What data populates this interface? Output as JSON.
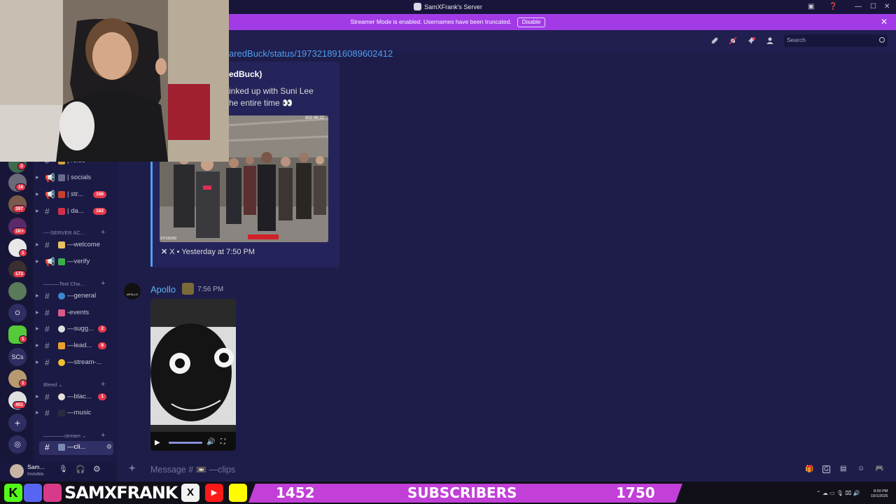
{
  "window": {
    "title": "SamXFrank's Server"
  },
  "banner": {
    "message": "Streamer Mode is enabled. Usernames have been truncated.",
    "disable_label": "Disable"
  },
  "header": {
    "search_placeholder": "Search"
  },
  "guilds": {
    "badges": [
      "3",
      "16",
      "397",
      "1K+",
      "1",
      "173",
      "1",
      "1",
      "401"
    ],
    "text_icons": [
      "O",
      "SCs"
    ]
  },
  "channels": {
    "items": [
      {
        "name": "| roles",
        "badge": ""
      },
      {
        "name": "| socials",
        "badge": ""
      },
      {
        "name": "| str...",
        "badge": "156"
      },
      {
        "name": "| da...",
        "badge": "162"
      },
      {
        "name": "—welcome",
        "badge": ""
      },
      {
        "name": "—verify",
        "badge": ""
      },
      {
        "name": "—general",
        "badge": ""
      },
      {
        "name": "-events",
        "badge": ""
      },
      {
        "name": "—sugg...",
        "badge": "2"
      },
      {
        "name": "—lead...",
        "badge": "8"
      },
      {
        "name": "—stream-...",
        "badge": ""
      },
      {
        "name": "—blac...",
        "badge": "1"
      },
      {
        "name": "—music",
        "badge": ""
      },
      {
        "name": "—cli...",
        "badge": ""
      }
    ],
    "categories": [
      "----SERVER AC...",
      "———Text Cha...",
      "Bleed",
      "————stream"
    ]
  },
  "user": {
    "name": "Sam...",
    "status": "Invisible"
  },
  "chat": {
    "embed_link": "aredBuck/status/1973218916089602412",
    "embed_author": "edBuck)",
    "embed_text_1": "inked up with Suni Lee",
    "embed_text_2": "he entire time 👀",
    "embed_footer": "X • Yesterday at 7:50 PM",
    "video_timer": "802:46:22",
    "video_counter": "37/16200",
    "message_author": "Apollo",
    "message_time": "7:56 PM",
    "avatar_text": "APOLLO"
  },
  "composer": {
    "placeholder": "Message # 📼 —clips"
  },
  "overlay": {
    "brand": "SAMXFRANK",
    "count_current": "1452",
    "label": "SUBSCRIBERS",
    "count_goal": "1750"
  },
  "taskbar": {
    "time": "8:50 PM",
    "date": "10/1/2025"
  },
  "colors": {
    "accent": "#a23be6",
    "link": "#4f9ff5",
    "badge": "#e8394a",
    "bg": "#1e1d4a"
  }
}
